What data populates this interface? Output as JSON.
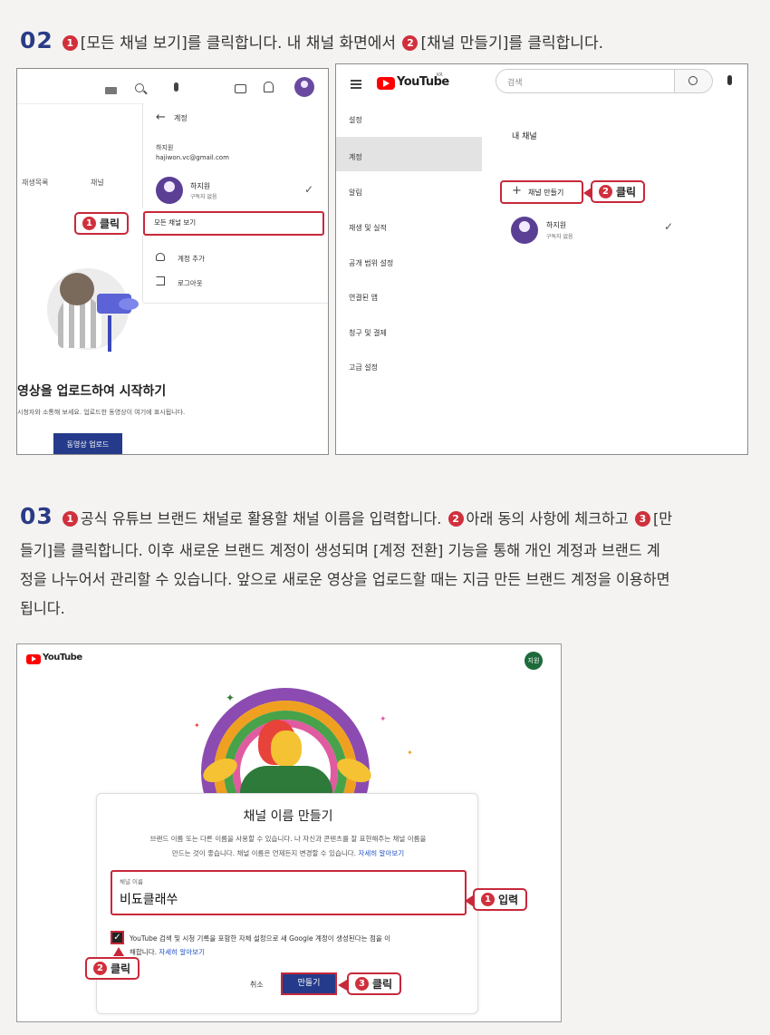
{
  "step02": {
    "number": "02",
    "badge1": "1",
    "text1": "[모든 채널 보기]를 클릭합니다. 내 채널 화면에서",
    "badge2": "2",
    "text2": "[채널 만들기]를 클릭합니다."
  },
  "left_panel": {
    "back_title": "계정",
    "user_name": "하지원",
    "user_email": "hajiwon.vc@gmail.com",
    "tab_playlist": "재생목록",
    "tab_channel": "채널",
    "account_name": "하지원",
    "account_sub": "구독자 없음",
    "view_all_channels": "모든 채널 보기",
    "add_account": "계정 추가",
    "logout": "로그아웃",
    "upload_heading": "영상을 업로드하여 시작하기",
    "upload_desc": "시청자와 소통해 보세요. 업로드한 동영상이 여기에 표시됩니다.",
    "upload_button": "동영상 업로드",
    "callout_badge": "1",
    "callout_label": "클릭"
  },
  "right_panel": {
    "logo_text": "YouTube",
    "logo_sup": "KR",
    "search_placeholder": "검색",
    "menu": [
      "설정",
      "계정",
      "알림",
      "재생 및 실적",
      "공개 범위 설정",
      "연결된 앱",
      "청구 및 결제",
      "고급 설정"
    ],
    "selected_index": 1,
    "my_channel_title": "내 채널",
    "create_channel": "채널 만들기",
    "channel_name": "하지원",
    "channel_sub": "구독자 없음",
    "callout_badge": "2",
    "callout_label": "클릭"
  },
  "step03": {
    "number": "03",
    "badge1": "1",
    "line1a": "공식 유튜브 브랜드 채널로 활용할 채널 이름을 입력합니다.",
    "badge2": "2",
    "line1b": "아래 동의 사항에 체크하고",
    "badge3": "3",
    "line1c": "[만",
    "line2": "들기]를 클릭합니다. 이후 새로운 브랜드 계정이 생성되며 [계정 전환] 기능을 통해 개인 계정과 브랜드 계",
    "line3": "정을 나누어서 관리할 수 있습니다. 앞으로 새로운 영상을 업로드할 때는 지금 만든 브랜드 계정을 이용하면",
    "line4": "됩니다."
  },
  "bottom_panel": {
    "logo_text": "YouTube",
    "avatar_text": "지원",
    "dialog_title": "채널 이름 만들기",
    "dialog_desc1": "브랜드 이름 또는 다른 이름을 사용할 수 있습니다. 나 자신과 콘텐츠를 잘 표현해주는 채널 이름을",
    "dialog_desc2": "만드는 것이 좋습니다. 채널 이름은 언제든지 변경할 수 있습니다.",
    "learn_more": "자세히 알아보기",
    "field_label": "채널 이름",
    "field_value": "비됴클래쑤",
    "consent_text1": "YouTube 검색 및 시청 기록을 포함한 자체 설정으로 새 Google 계정이 생성된다는 점을 이",
    "consent_text2": "해합니다.",
    "consent_learn_more": "자세히 알아보기",
    "cancel": "취소",
    "create": "만들기",
    "callout_input_badge": "1",
    "callout_input_label": "입력",
    "callout_check_badge": "2",
    "callout_check_label": "클릭",
    "callout_create_badge": "3",
    "callout_create_label": "클릭"
  },
  "colors": {
    "accent_red": "#c8283a",
    "badge_red": "#d0303c",
    "navy": "#253a8a",
    "youtube_red": "#ff0000"
  }
}
